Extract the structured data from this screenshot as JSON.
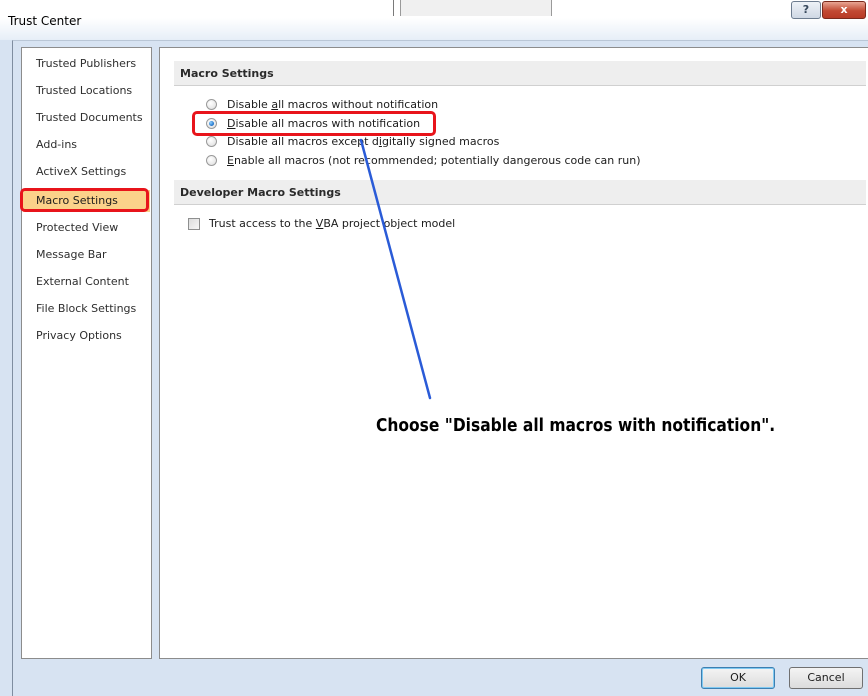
{
  "window": {
    "title": "Trust Center",
    "help_label": "?",
    "close_label": "x"
  },
  "nav": {
    "items": [
      {
        "label": "Trusted Publishers"
      },
      {
        "label": "Trusted Locations"
      },
      {
        "label": "Trusted Documents"
      },
      {
        "label": "Add-ins"
      },
      {
        "label": "ActiveX Settings"
      },
      {
        "label": "Macro Settings",
        "selected": true
      },
      {
        "label": "Protected View"
      },
      {
        "label": "Message Bar"
      },
      {
        "label": "External Content"
      },
      {
        "label": "File Block Settings"
      },
      {
        "label": "Privacy Options"
      }
    ]
  },
  "macro_settings": {
    "header": "Macro Settings",
    "options": [
      {
        "pre": "Disable ",
        "key": "a",
        "post": "ll macros without notification",
        "checked": false
      },
      {
        "pre": "",
        "key": "D",
        "post": "isable all macros with notification",
        "checked": true
      },
      {
        "pre": "Disable all macros except d",
        "key": "i",
        "post": "gitally signed macros",
        "checked": false
      },
      {
        "pre": "",
        "key": "E",
        "post": "nable all macros (not recommended; potentially dangerous code can run)",
        "checked": false
      }
    ]
  },
  "developer": {
    "header": "Developer Macro Settings",
    "checkbox": {
      "pre": "Trust access to the ",
      "key": "V",
      "post": "BA project object model",
      "checked": false
    }
  },
  "annotation": {
    "text": "Choose \"Disable all macros with notification\"."
  },
  "footer": {
    "ok_label": "OK",
    "cancel_label": "Cancel"
  },
  "colors": {
    "highlight_border": "#e8141b",
    "arrow": "#2a5bd7",
    "selected_nav": "#fbd28a"
  }
}
